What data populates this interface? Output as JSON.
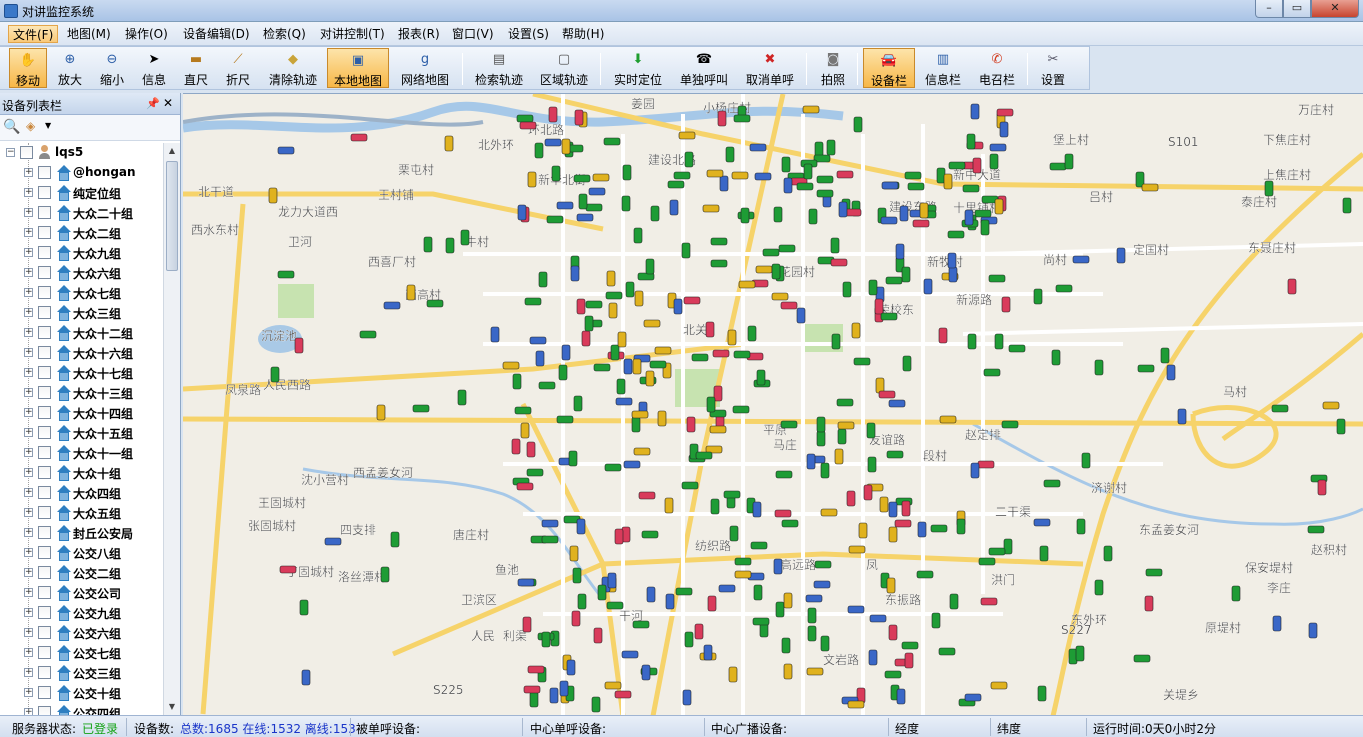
{
  "window": {
    "title": "对讲监控系统",
    "min": "–",
    "max": "▭",
    "close": "✕"
  },
  "menu": [
    {
      "label": "文件(F)"
    },
    {
      "label": "地图(M)"
    },
    {
      "label": "操作(O)"
    },
    {
      "label": "设备编辑(D)"
    },
    {
      "label": "检索(Q)"
    },
    {
      "label": "对讲控制(T)"
    },
    {
      "label": "报表(R)"
    },
    {
      "label": "窗口(V)"
    },
    {
      "label": "设置(S)"
    },
    {
      "label": "帮助(H)"
    }
  ],
  "toolbar": [
    {
      "label": "移动",
      "icon": "hand-icon"
    },
    {
      "label": "放大",
      "icon": "zoom-in-icon"
    },
    {
      "label": "缩小",
      "icon": "zoom-out-icon"
    },
    {
      "label": "信息",
      "icon": "pointer-icon"
    },
    {
      "label": "直尺",
      "icon": "ruler-icon"
    },
    {
      "label": "折尺",
      "icon": "polyline-ruler-icon"
    },
    {
      "label": "清除轨迹",
      "icon": "eraser-icon"
    },
    {
      "label": "本地地图",
      "icon": "local-map-icon"
    },
    {
      "label": "网络地图",
      "icon": "google-map-icon"
    },
    {
      "label": "检索轨迹",
      "icon": "track-search-icon"
    },
    {
      "label": "区域轨迹",
      "icon": "area-track-icon"
    },
    {
      "label": "实时定位",
      "icon": "locate-arrow-icon"
    },
    {
      "label": "单独呼叫",
      "icon": "single-call-icon"
    },
    {
      "label": "取消单呼",
      "icon": "cancel-call-icon"
    },
    {
      "label": "拍照",
      "icon": "camera-icon"
    },
    {
      "label": "设备栏",
      "icon": "vehicle-bar-icon"
    },
    {
      "label": "信息栏",
      "icon": "book-icon"
    },
    {
      "label": "电召栏",
      "icon": "phone-icon"
    },
    {
      "label": "设置",
      "icon": "tools-icon"
    }
  ],
  "panel": {
    "title": "设备列表栏",
    "pin": "📌",
    "close": "✕",
    "root": "lqs5",
    "groups": [
      "@hongan",
      "纯定位组",
      "大众二十组",
      "大众二组",
      "大众九组",
      "大众六组",
      "大众七组",
      "大众三组",
      "大众十二组",
      "大众十六组",
      "大众十七组",
      "大众十三组",
      "大众十四组",
      "大众十五组",
      "大众十一组",
      "大众十组",
      "大众四组",
      "大众五组",
      "封丘公安局",
      "公交八组",
      "公交二组",
      "公交公司",
      "公交九组",
      "公交六组",
      "公交七组",
      "公交三组",
      "公交十组",
      "公交四组"
    ]
  },
  "map": {
    "labels": [
      "小杨庄村",
      "姜园",
      "环北路",
      "北外环",
      "新华北街",
      "建设北路",
      "栗屯村",
      "王村铺",
      "北干道",
      "龙力大道西",
      "西水东村",
      "卫河",
      "牛村",
      "西喜厂村",
      "西高村",
      "人民西路",
      "沉淀池",
      "凤泉路",
      "西孟姜女河",
      "沈小营村",
      "王固城村",
      "张固城村",
      "四支排",
      "丁固城村",
      "洛丝潭村",
      "唐庄村",
      "卫滨区",
      "人民",
      "利渠",
      "S225",
      "新中大道",
      "建设东路",
      "十里铺村",
      "堡上村",
      "吕村",
      "S101",
      "万庄村",
      "下焦庄村",
      "上焦庄村",
      "泰庄村",
      "东聂庄村",
      "定国村",
      "尚村",
      "新牧村",
      "荣校东",
      "新源路",
      "平原",
      "友谊路",
      "段村",
      "赵定排",
      "马村",
      "济谢村",
      "东孟姜女河",
      "赵积村",
      "保安堤村",
      "李庄",
      "原堤村",
      "二干渠",
      "洪门",
      "东外环",
      "S227",
      "纺织路",
      "东振路",
      "文岩路",
      "高远路",
      "关堤乡",
      "北关",
      "花园村",
      "马庄",
      "鱼池",
      "凤",
      "干河"
    ]
  },
  "status": {
    "server_label": "服务器状态:",
    "server_value": "已登录",
    "devices_label": "设备数:",
    "devices_value": "总数:1685 在线:1532 离线:153",
    "called_label": "被单呼设备:",
    "center_single_label": "中心单呼设备:",
    "center_broadcast_label": "中心广播设备:",
    "lon_label": "经度",
    "lat_label": "纬度",
    "runtime": "运行时间:0天0小时2分"
  }
}
